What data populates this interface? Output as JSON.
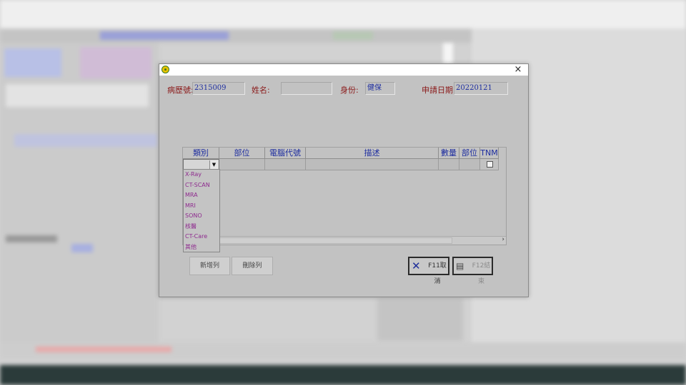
{
  "dialog": {
    "close_glyph": "×",
    "fields": {
      "chart_no_label": "病歷號:",
      "chart_no_value": "2315009",
      "name_label": "姓名:",
      "name_value": "",
      "identity_label": "身份:",
      "identity_value": "健保",
      "apply_date_label": "申請日期:",
      "apply_date_value": "20220121"
    },
    "grid": {
      "headers": [
        "類別",
        "部位",
        "電腦代號",
        "描述",
        "數量",
        "部位",
        "TNM"
      ],
      "combo_arrow": "▼",
      "scroll_right": "›",
      "category_options": [
        "X-Ray",
        "CT-SCAN",
        "MRA",
        "MRI",
        "SONO",
        "核醫",
        "CT-Care",
        "其他"
      ]
    },
    "buttons": {
      "add_row": "新增列",
      "delete_row": "刪除列",
      "cancel": "F11取消",
      "finish": "F12結束"
    },
    "icons": {
      "app": "app-icon",
      "cancel": "cancel-x-icon",
      "finish": "finish-icon"
    },
    "colors": {
      "label": "#8b1a1a",
      "value": "#1e2ea0",
      "option": "#8e2a8e"
    }
  }
}
